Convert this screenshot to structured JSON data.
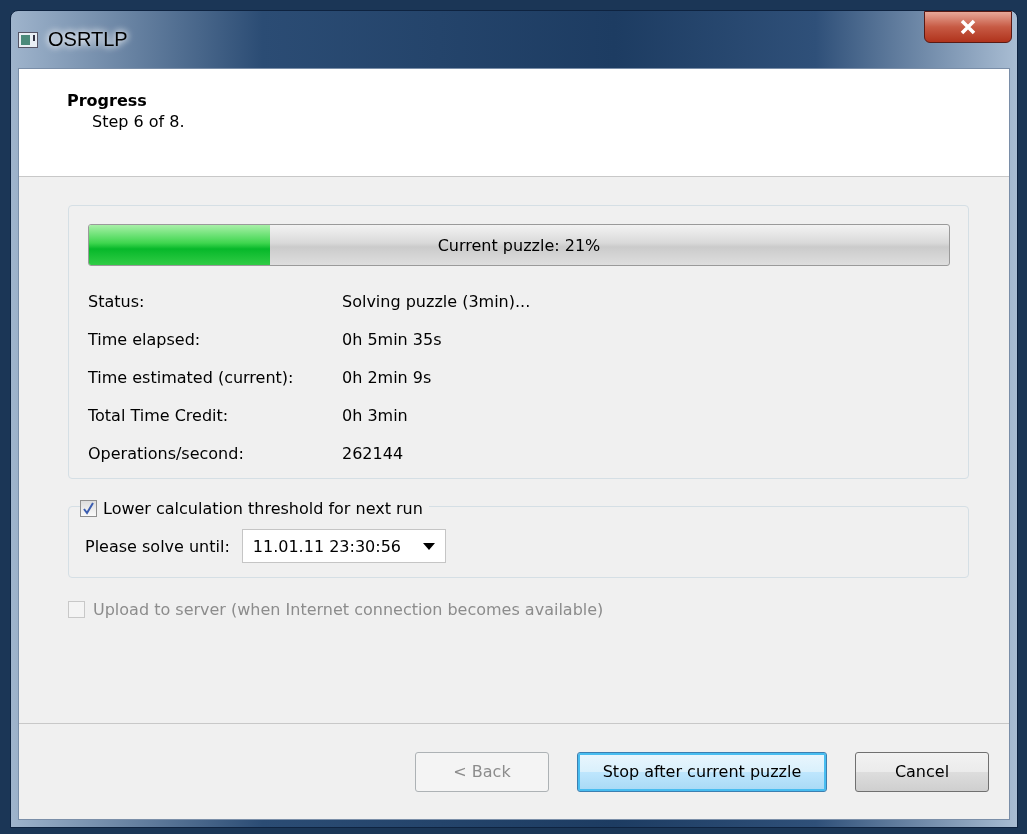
{
  "window": {
    "title": "OSRTLP"
  },
  "header": {
    "title": "Progress",
    "subtitle": "Step 6 of 8."
  },
  "progress": {
    "label": "Current puzzle: 21%",
    "level": 0.21
  },
  "details": [
    {
      "label": "Status:",
      "value": "Solving puzzle (3min)..."
    },
    {
      "label": "Time elapsed:",
      "value": "0h 5min 35s"
    },
    {
      "label": "Time estimated (current):",
      "value": "0h 2min 9s"
    },
    {
      "label": "Total Time Credit:",
      "value": "0h 3min"
    },
    {
      "label": "Operations/second:",
      "value": "262144"
    }
  ],
  "threshold": {
    "label": "Lower calculation threshold for next run",
    "checked": true,
    "until_label": "Please solve until:",
    "until_value": "11.01.11 23:30:56"
  },
  "upload": {
    "label": "Upload to server (when Internet connection becomes available)",
    "checked": false,
    "disabled": true
  },
  "buttons": [
    {
      "label": "< Back",
      "disabled": true,
      "default": false
    },
    {
      "label": "Stop after current puzzle",
      "disabled": false,
      "default": true
    },
    {
      "label": "Cancel",
      "disabled": false,
      "default": false
    }
  ]
}
